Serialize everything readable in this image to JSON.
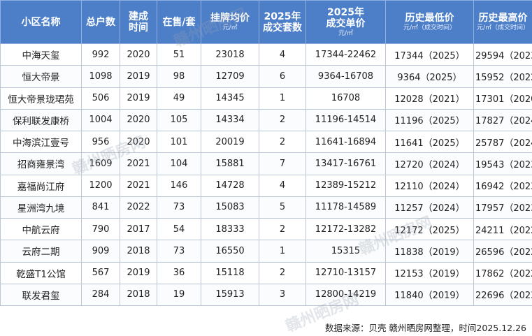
{
  "headers": [
    {
      "l1": "小区名称",
      "l2": "",
      "unit": ""
    },
    {
      "l1": "总户数",
      "l2": "",
      "unit": ""
    },
    {
      "l1": "建成",
      "l2": "时间",
      "unit": ""
    },
    {
      "l1": "在售/套",
      "l2": "",
      "unit": ""
    },
    {
      "l1": "挂牌均价",
      "l2": "",
      "unit": "元/㎡"
    },
    {
      "l1": "2025年",
      "l2": "成交套数",
      "unit": ""
    },
    {
      "l1": "2025年",
      "l2": "成交单价",
      "unit": "元/㎡"
    },
    {
      "l1": "历史最低价",
      "l2": "",
      "unit": "元/㎡（成交时间）"
    },
    {
      "l1": "历史最高价",
      "l2": "",
      "unit": "元/㎡（成交时间）"
    }
  ],
  "rows": [
    [
      "中海天玺",
      "992",
      "2020",
      "51",
      "23018",
      "4",
      "17344-22462",
      "17344（2025）",
      "29594（2023）"
    ],
    [
      "恒大帝景",
      "1098",
      "2019",
      "98",
      "12709",
      "6",
      "9364-16708",
      "9364（2025）",
      "15952（2022）"
    ],
    [
      "恒大帝景珑珺苑",
      "506",
      "2019",
      "49",
      "14345",
      "1",
      "16708",
      "12028（2021）",
      "17301（2020）"
    ],
    [
      "保利联发康桥",
      "1004",
      "2020",
      "105",
      "14334",
      "2",
      "11196-14514",
      "11196（2025）",
      "17827（2024）"
    ],
    [
      "中海滨江壹号",
      "956",
      "2020",
      "101",
      "20019",
      "2",
      "11641-16894",
      "11641（2025）",
      "25787（2024）"
    ],
    [
      "招商雍景湾",
      "1609",
      "2021",
      "104",
      "15881",
      "7",
      "13417-16761",
      "12720（2024）",
      "19543（2023）"
    ],
    [
      "嘉福尚江府",
      "1200",
      "2021",
      "146",
      "14728",
      "4",
      "12389-15212",
      "12110（2024）",
      "16942（2023）"
    ],
    [
      "星洲湾九境",
      "841",
      "2022",
      "73",
      "15083",
      "5",
      "11178-14589",
      "11257（2024）",
      "17957（2023）"
    ],
    [
      "中航云府",
      "790",
      "2017",
      "54",
      "18333",
      "2",
      "12172-13282",
      "12172（2025）",
      "24211（2022）"
    ],
    [
      "云府二期",
      "909",
      "2018",
      "73",
      "16550",
      "1",
      "15315",
      "11838（2019）",
      "26596（2022）"
    ],
    [
      "乾盛T1公馆",
      "567",
      "2019",
      "36",
      "15118",
      "2",
      "12710-13157",
      "12153（2019）",
      "17862（2022）"
    ],
    [
      "联发君玺",
      "284",
      "2018",
      "19",
      "15913",
      "3",
      "12800-14219",
      "11840（2019）",
      "22696（2023）"
    ]
  ],
  "footer": "数据来源：贝壳  赣州晒房网整理，时间2025.12.26",
  "watermark": "赣州晒房网"
}
